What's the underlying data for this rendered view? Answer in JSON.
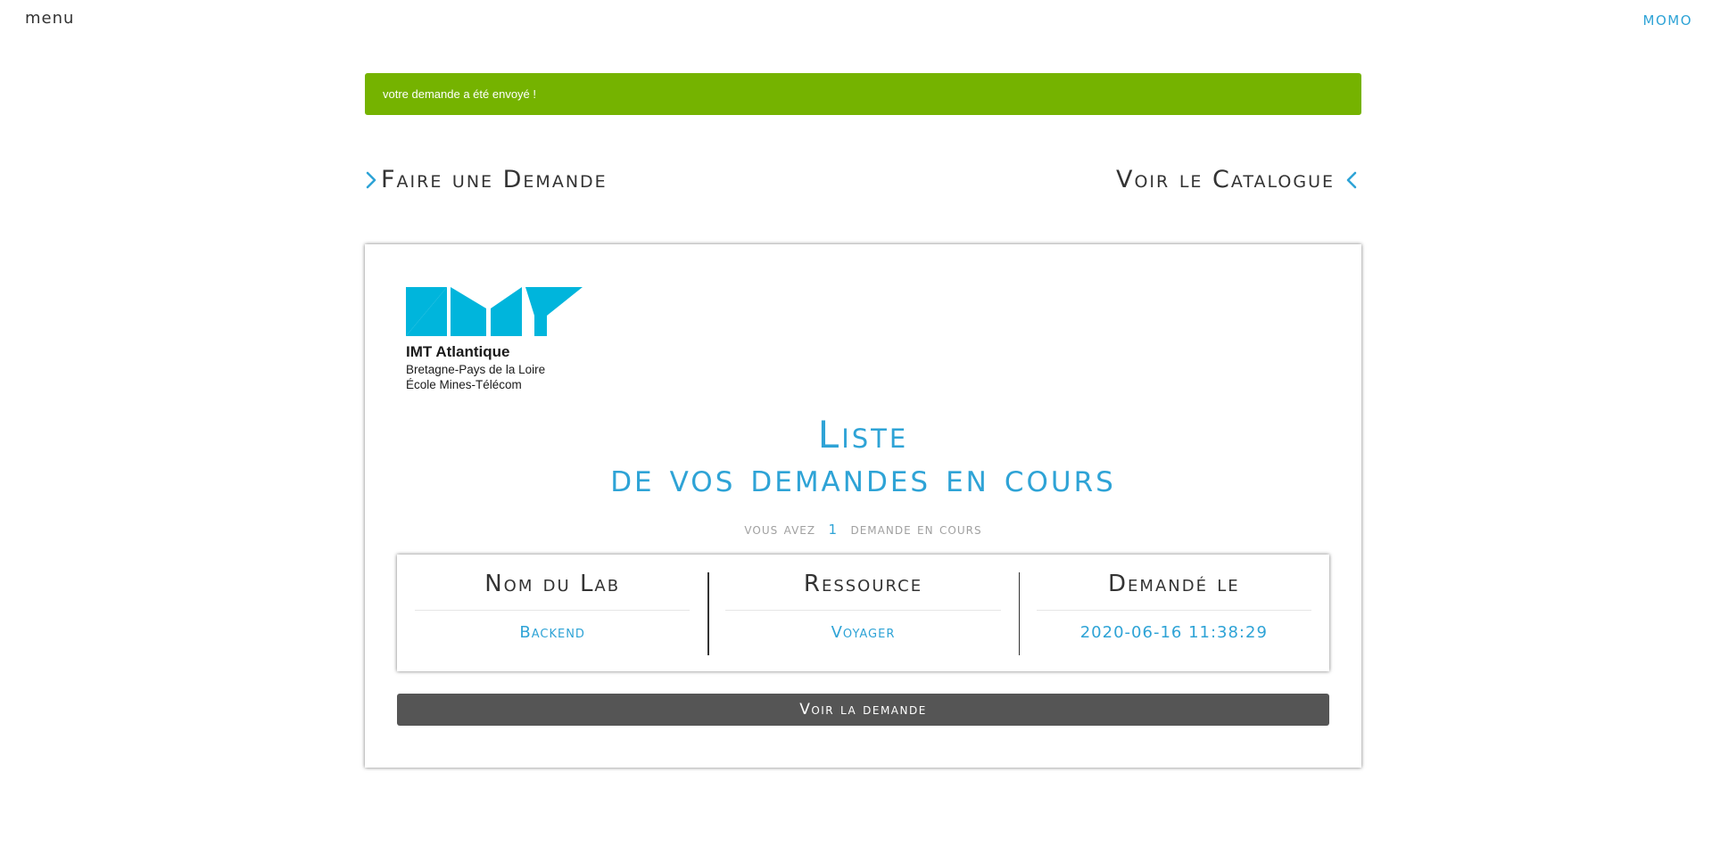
{
  "header": {
    "menu_label": "menu",
    "user_label": "MOMO"
  },
  "alert": {
    "message": "votre demande a été envoyé !",
    "color": "#75b300"
  },
  "nav": {
    "left_label": "Faire une Demande",
    "right_label": "Voir le Catalogue",
    "left_icon": "chevron-right-icon",
    "right_icon": "chevron-left-icon"
  },
  "logo": {
    "name": "IMT Atlantique",
    "line1": "Bretagne-Pays de la Loire",
    "line2": "École Mines-Télécom",
    "color": "#00b5dc"
  },
  "list": {
    "title_line1": "Liste",
    "title_line2": "de vos demandes en cours",
    "count_prefix": "vous avez",
    "count": "1",
    "count_suffix": "demande en cours"
  },
  "request": {
    "columns": [
      {
        "header": "Nom du Lab",
        "value": "Backend"
      },
      {
        "header": "Ressource",
        "value": "Voyager"
      },
      {
        "header": "Demandé le",
        "value": "2020-06-16 11:38:29"
      }
    ],
    "button_label": "Voir la demande"
  },
  "colors": {
    "accent": "#2ea3d6",
    "button": "#555555",
    "text": "#333333"
  }
}
